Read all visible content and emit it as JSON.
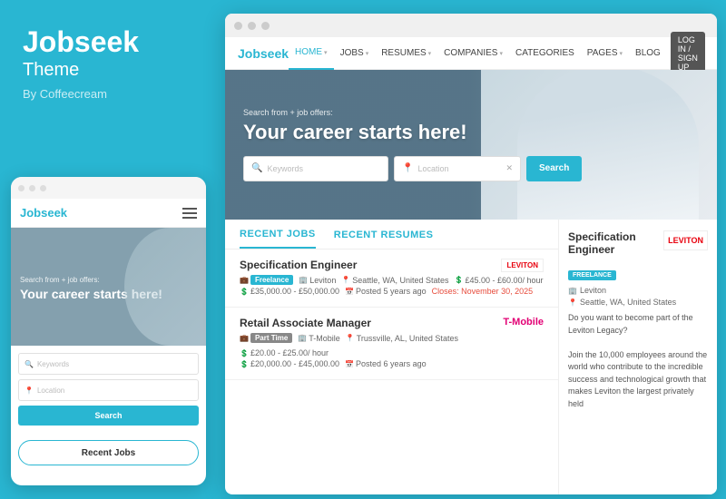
{
  "left": {
    "brand_title": "Jobseek",
    "brand_subtitle": "Theme",
    "brand_by": "By Coffeecream"
  },
  "mobile": {
    "nav_brand": "Jobseek",
    "hero_small": "Search from + job offers:",
    "hero_title": "Your career starts here!",
    "keywords_placeholder": "Keywords",
    "location_placeholder": "Location",
    "search_btn": "Search",
    "recent_jobs_btn": "Recent Jobs"
  },
  "browser": {
    "nav_brand": "Jobseek",
    "nav_items": [
      {
        "label": "HOME",
        "has_chevron": true,
        "active": true
      },
      {
        "label": "JOBS",
        "has_chevron": true,
        "active": false
      },
      {
        "label": "RESUMES",
        "has_chevron": true,
        "active": false
      },
      {
        "label": "COMPANIES",
        "has_chevron": true,
        "active": false
      },
      {
        "label": "CATEGORIES",
        "has_chevron": false,
        "active": false
      },
      {
        "label": "PAGES",
        "has_chevron": true,
        "active": false
      },
      {
        "label": "BLOG",
        "has_chevron": false,
        "active": false
      }
    ],
    "login_label": "LOG IN / SIGN UP",
    "hero_small": "Search from + job offers:",
    "hero_title": "Your career starts here!",
    "keywords_placeholder": "Keywords",
    "location_placeholder": "Location",
    "search_btn": "Search",
    "tabs": [
      {
        "label": "RECENT JOBS",
        "active": true
      },
      {
        "label": "RECENT RESUMES",
        "active": false
      }
    ],
    "jobs": [
      {
        "title": "Specification Engineer",
        "type": "Freelance",
        "company": "Leviton",
        "location": "Seattle, WA, United States",
        "salary": "£45.00 - £60.00/ hour",
        "salary2": "£35,000.00 - £50,000.00",
        "posted": "Posted 5 years ago",
        "closes": "Closes: November 30, 2025",
        "logo": "LEVITON",
        "logo_color": "#e8000d"
      },
      {
        "title": "Retail Associate Manager",
        "type": "Part Time",
        "company": "T-Mobile",
        "location": "Trussville, AL, United States",
        "salary": "£20.00 - £25.00/ hour",
        "salary2": "£20,000.00 - £45,000.00",
        "posted": "Posted 6 years ago",
        "closes": "",
        "logo": "T-Mobile",
        "logo_color": "#e20074"
      }
    ],
    "sidebar": {
      "job_title": "Specification Engineer",
      "badge": "FREELANCE",
      "company": "Leviton",
      "location": "Seattle, WA, United States",
      "logo": "LEVITON",
      "description": "Do you want to become part of the Leviton Legacy?\n\nJoin the 10,000 employees around the world who contribute to the incredible success and technological growth that makes Leviton the largest privately held"
    }
  }
}
